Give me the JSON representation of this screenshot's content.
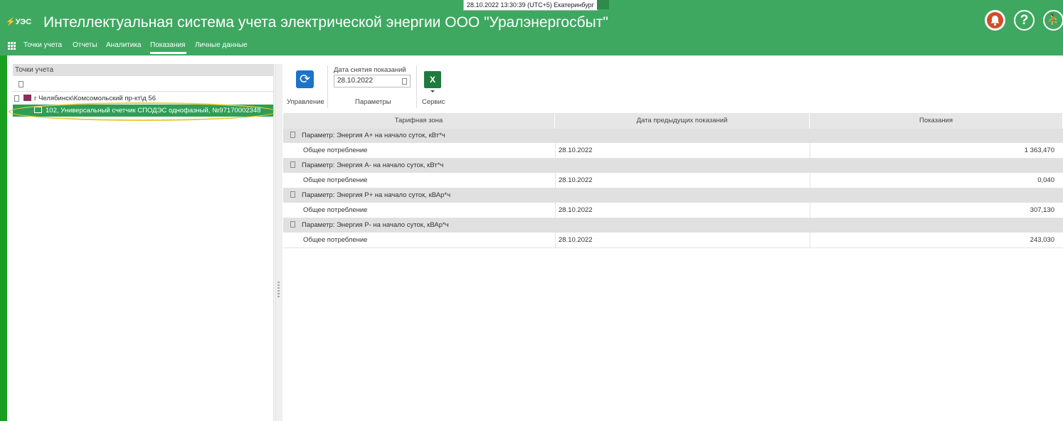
{
  "header": {
    "datetime": "28.10.2022 13:30:39 (UTC+5) Екатеринбург",
    "logo_text": "УЭС",
    "title": "Интеллектуальная система учета электрической энергии ООО \"Уралэнергосбыт\"",
    "help_glyph": "?",
    "exit_glyph": "⛹"
  },
  "nav": {
    "items": [
      {
        "label": "Точки учета"
      },
      {
        "label": "Отчеты"
      },
      {
        "label": "Аналитика"
      },
      {
        "label": "Показания"
      },
      {
        "label": "Личные данные"
      }
    ],
    "active": "Показания"
  },
  "left_panel": {
    "header": "Точки учета",
    "tree": {
      "folder": "г Челябинск\\Комсомольский пр-кт\\д 56",
      "meter": "102, Универсальный счетчик СПОДЭС однофазный, №97170002348"
    }
  },
  "toolbar": {
    "manage_label": "Управление",
    "date_label": "Дата снятия показаний",
    "date_value": "28.10.2022",
    "params_label": "Параметры",
    "excel_glyph": "X",
    "service_label": "Сервис"
  },
  "grid": {
    "columns": [
      "Тарифная зона",
      "Дата предыдущих показаний",
      "Показания"
    ],
    "groups": [
      {
        "title": "Параметр: Энергия А+ на начало суток, кВт*ч",
        "row": {
          "name": "Общее потребление",
          "date": "28.10.2022",
          "value": "1 363,470"
        }
      },
      {
        "title": "Параметр: Энергия А- на начало суток, кВт*ч",
        "row": {
          "name": "Общее потребление",
          "date": "28.10.2022",
          "value": "0,040"
        }
      },
      {
        "title": "Параметр: Энергия Р+ на начало суток, кВАр*ч",
        "row": {
          "name": "Общее потребление",
          "date": "28.10.2022",
          "value": "307,130"
        }
      },
      {
        "title": "Параметр: Энергия Р- на начало суток, кВАр*ч",
        "row": {
          "name": "Общее потребление",
          "date": "28.10.2022",
          "value": "243,030"
        }
      }
    ]
  },
  "colors": {
    "header_green": "#3ea860",
    "selected_row": "#2e9e56",
    "highlight": "#e8c93d",
    "refresh_blue": "#1b74c9",
    "excel_green": "#1f7a3e"
  },
  "icons": [
    "bolt-logo-icon",
    "bell-icon",
    "help-icon",
    "exit-icon",
    "apps-grid-icon",
    "folder-icon",
    "meter-icon",
    "refresh-icon",
    "excel-icon",
    "calendar-icon"
  ]
}
